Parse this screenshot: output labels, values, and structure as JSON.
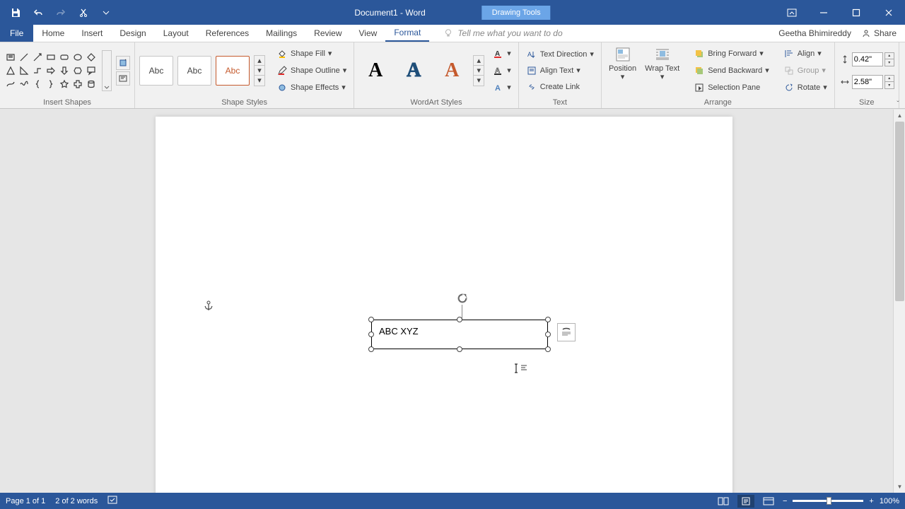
{
  "title": "Document1 - Word",
  "contextual_tab": "Drawing Tools",
  "menus": [
    "File",
    "Home",
    "Insert",
    "Design",
    "Layout",
    "References",
    "Mailings",
    "Review",
    "View",
    "Format"
  ],
  "active_menu": "Format",
  "tell_me": "Tell me what you want to do",
  "user": "Geetha Bhimireddy",
  "share": "Share",
  "ribbon": {
    "insert_shapes": "Insert Shapes",
    "shape_styles": "Shape Styles",
    "wordart_styles": "WordArt Styles",
    "text_group": "Text",
    "arrange": "Arrange",
    "size": "Size",
    "style_thumb": "Abc",
    "shape_fill": "Shape Fill",
    "shape_outline": "Shape Outline",
    "shape_effects": "Shape Effects",
    "wa_letter": "A",
    "text_direction": "Text Direction",
    "align_text": "Align Text",
    "create_link": "Create Link",
    "position": "Position",
    "wrap_text": "Wrap Text",
    "bring_forward": "Bring Forward",
    "send_backward": "Send Backward",
    "selection_pane": "Selection Pane",
    "align": "Align",
    "group": "Group",
    "rotate": "Rotate",
    "height": "0.42\"",
    "width": "2.58\""
  },
  "document": {
    "textbox_text": "ABC XYZ"
  },
  "status": {
    "page": "Page 1 of 1",
    "words": "2 of 2 words",
    "zoom": "100%"
  }
}
